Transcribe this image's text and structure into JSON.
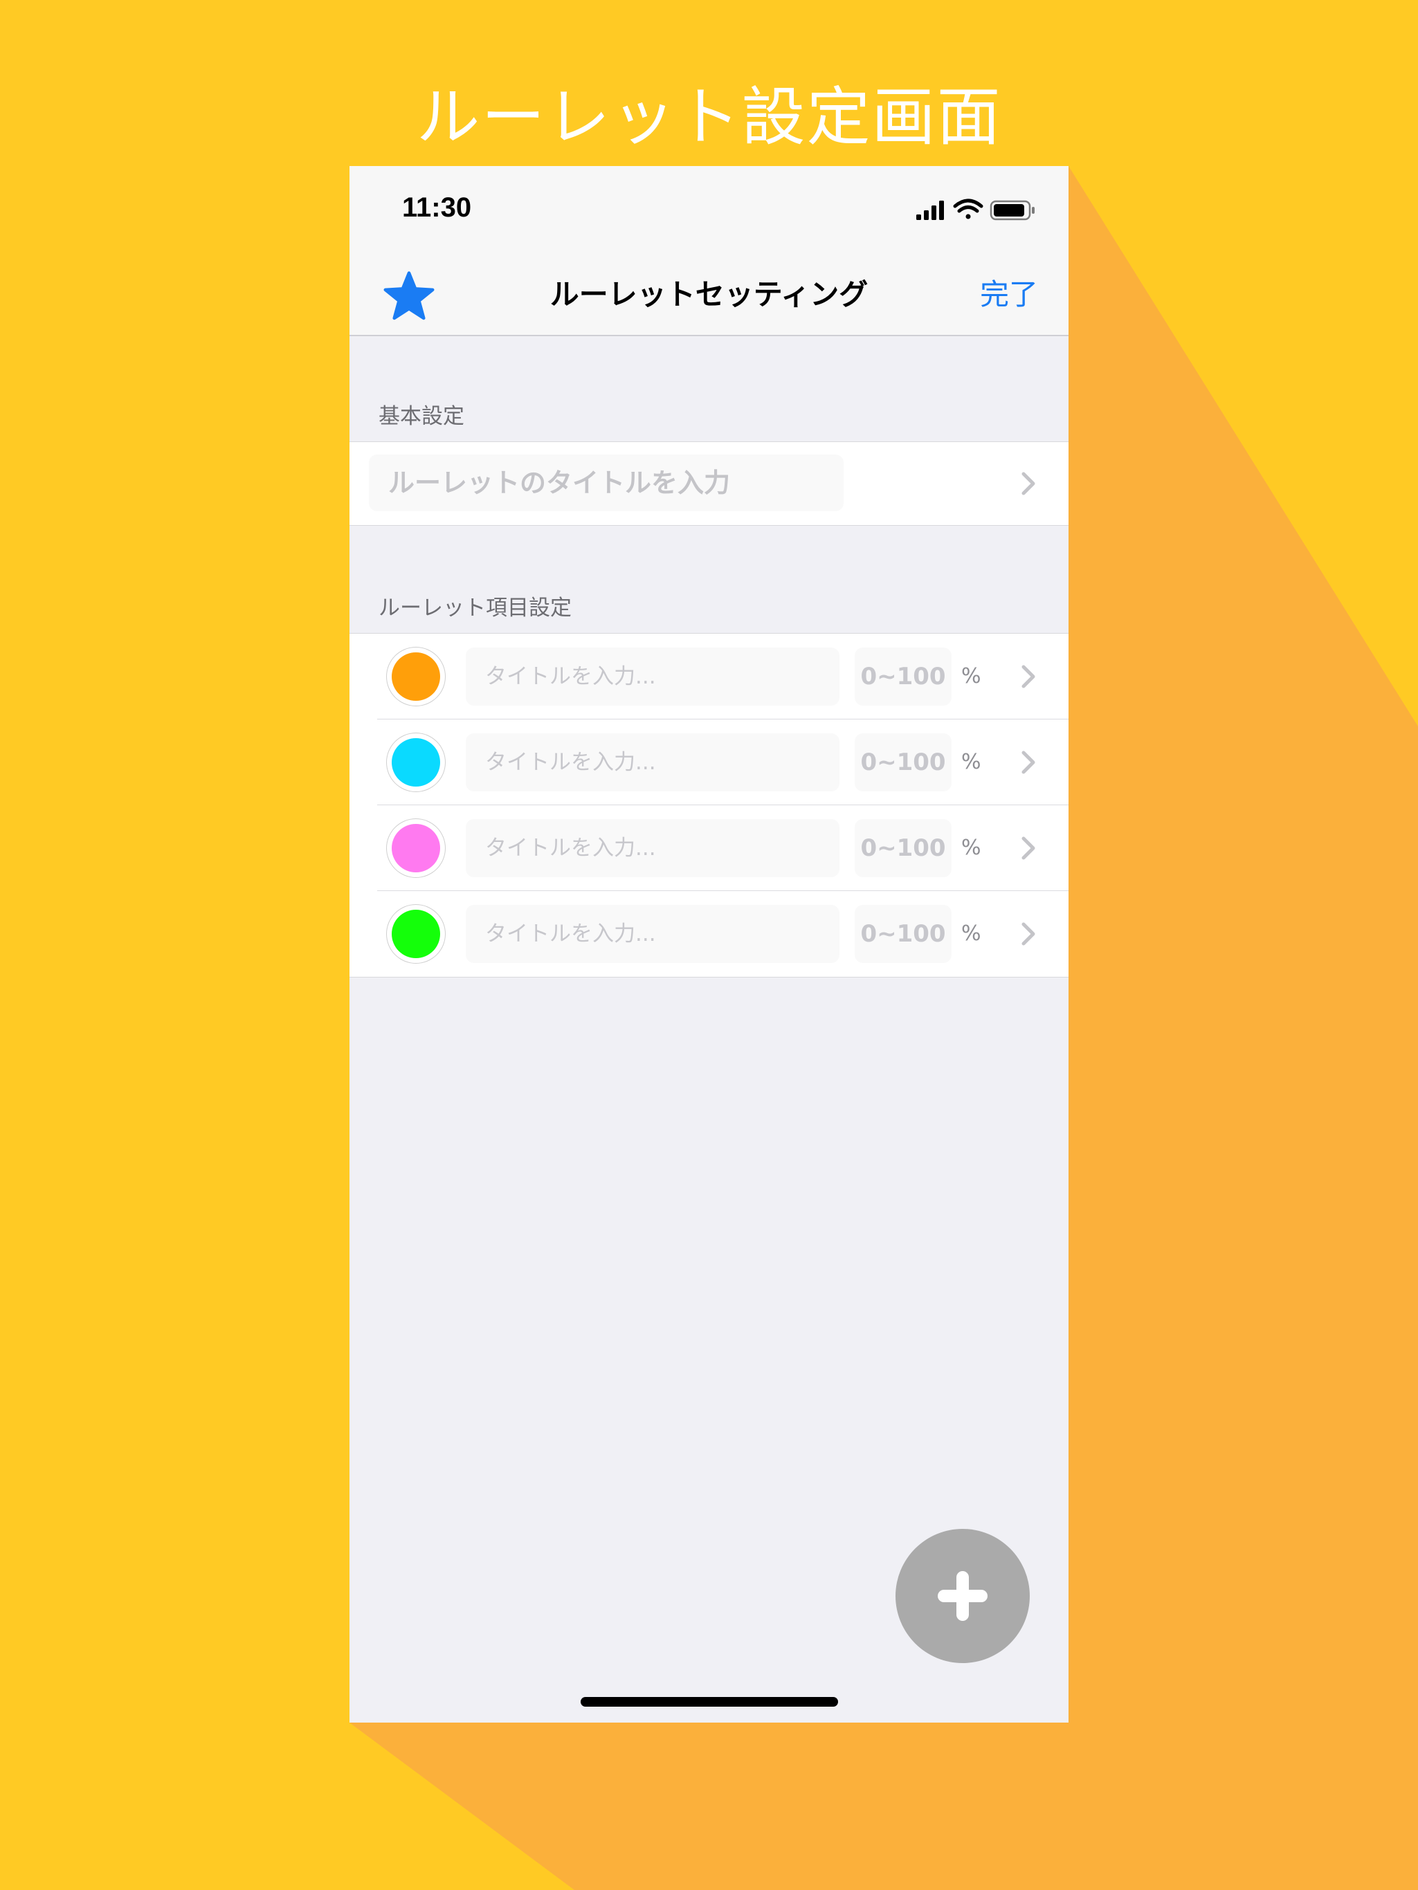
{
  "promo": {
    "title": "ルーレット設定画面"
  },
  "status_bar": {
    "time": "11:30",
    "icons": [
      "signal-icon",
      "wifi-icon",
      "battery-icon"
    ]
  },
  "nav": {
    "left_icon": "star-icon",
    "title": "ルーレットセッティング",
    "done_label": "完了"
  },
  "sections": {
    "basic": {
      "header": "基本設定",
      "title_placeholder": "ルーレットのタイトルを入力"
    },
    "items": {
      "header": "ルーレット項目設定",
      "rows": [
        {
          "color": "#FF9F0A",
          "title_placeholder": "タイトルを入力...",
          "percent_placeholder": "0~100",
          "percent_sign": "%"
        },
        {
          "color": "#0ADAFF",
          "title_placeholder": "タイトルを入力...",
          "percent_placeholder": "0~100",
          "percent_sign": "%"
        },
        {
          "color": "#FF7AF0",
          "title_placeholder": "タイトルを入力...",
          "percent_placeholder": "0~100",
          "percent_sign": "%"
        },
        {
          "color": "#14FF0A",
          "title_placeholder": "タイトルを入力...",
          "percent_placeholder": "0~100",
          "percent_sign": "%"
        }
      ]
    }
  },
  "fab": {
    "icon": "plus-icon"
  },
  "colors": {
    "background": "#FFCA24",
    "shadow": "#FBB03B",
    "accent": "#1A7CF3",
    "fab": "#AAAAAA"
  }
}
